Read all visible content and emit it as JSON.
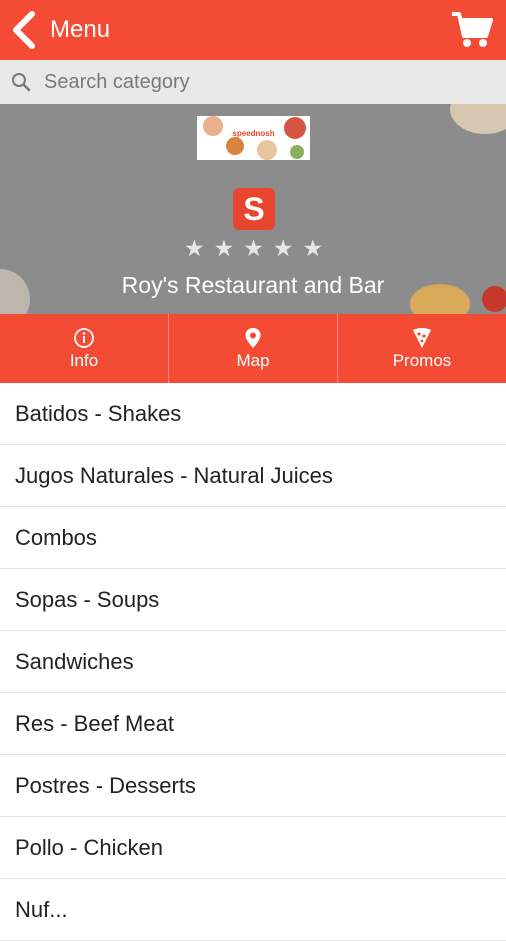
{
  "header": {
    "title": "Menu",
    "back_icon": "chevron-left-icon",
    "cart_icon": "shopping-cart-icon"
  },
  "search": {
    "placeholder": "Search category",
    "value": ""
  },
  "restaurant": {
    "name": "Roy's Restaurant and Bar",
    "banner_text": "speednosh",
    "logo_letter": "S",
    "rating_stars": 5,
    "star_glyph": "★"
  },
  "actions": [
    {
      "label": "Info",
      "icon": "info-icon"
    },
    {
      "label": "Map",
      "icon": "map-pin-icon"
    },
    {
      "label": "Promos",
      "icon": "pizza-slice-icon"
    }
  ],
  "categories": [
    "Batidos - Shakes",
    "Jugos Naturales - Natural Juices",
    "Combos",
    "Sopas - Soups",
    "Sandwiches",
    "Res - Beef Meat",
    "Postres - Desserts",
    "Pollo - Chicken",
    "Nuf..."
  ],
  "colors": {
    "primary": "#f44b35",
    "hero_bg": "#8c8c8c",
    "search_bg": "#e9e9e9"
  }
}
